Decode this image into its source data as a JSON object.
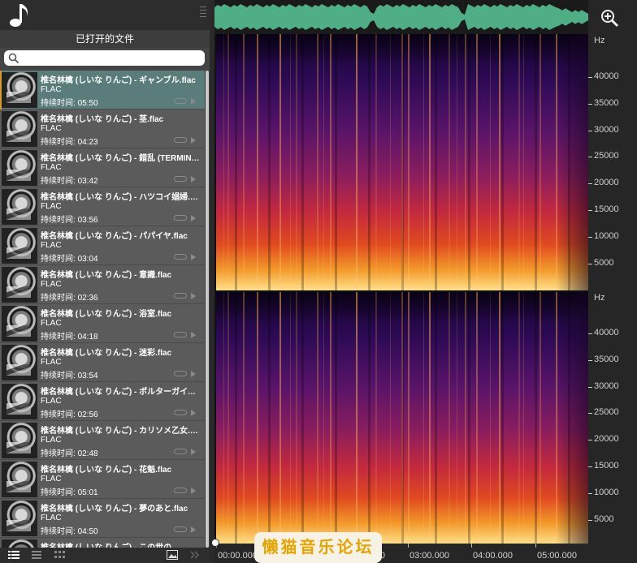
{
  "sidebar": {
    "title": "已打开的文件",
    "search": {
      "value": "",
      "placeholder": ""
    },
    "files": [
      {
        "name": "椎名林檎 (しいな りんご) - ギャンブル.flac",
        "format": "FLAC",
        "duration_label": "持续时间: ",
        "duration": "05:50",
        "active": true
      },
      {
        "name": "椎名林檎 (しいな りんご) - 茎.flac",
        "format": "FLAC",
        "duration_label": "持续时间: ",
        "duration": "04:23"
      },
      {
        "name": "椎名林檎 (しいな りんご) - 錯乱 (TERMINAL).flac",
        "format": "FLAC",
        "duration_label": "持续时间: ",
        "duration": "03:42"
      },
      {
        "name": "椎名林檎 (しいな りんご) - ハツコイ娼婦.flac",
        "format": "FLAC",
        "duration_label": "持续时间: ",
        "duration": "03:56"
      },
      {
        "name": "椎名林檎 (しいな りんご) - パパイヤ.flac",
        "format": "FLAC",
        "duration_label": "持续时间: ",
        "duration": "03:04"
      },
      {
        "name": "椎名林檎 (しいな りんご) - 意識.flac",
        "format": "FLAC",
        "duration_label": "持续时间: ",
        "duration": "02:36"
      },
      {
        "name": "椎名林檎 (しいな りんご) - 浴室.flac",
        "format": "FLAC",
        "duration_label": "持续时间: ",
        "duration": "04:18"
      },
      {
        "name": "椎名林檎 (しいな りんご) - 迷彩.flac",
        "format": "FLAC",
        "duration_label": "持续时间: ",
        "duration": "03:54"
      },
      {
        "name": "椎名林檎 (しいな りんご) - ポルターガイスト.flac",
        "format": "FLAC",
        "duration_label": "持续时间: ",
        "duration": "02:56"
      },
      {
        "name": "椎名林檎 (しいな りんご) - カリソメ乙女.flac",
        "format": "FLAC",
        "duration_label": "持续时间: ",
        "duration": "02:48"
      },
      {
        "name": "椎名林檎 (しいな りんご) - 花魁.flac",
        "format": "FLAC",
        "duration_label": "持续时间: ",
        "duration": "05:01"
      },
      {
        "name": "椎名林檎 (しいな りんご) - 夢のあと.flac",
        "format": "FLAC",
        "duration_label": "持续时间: ",
        "duration": "04:50"
      },
      {
        "name": "椎名林檎 (しいな りんご) - この世の",
        "format": "FLAC",
        "duration_label": "持续时间: ",
        "duration": ""
      }
    ]
  },
  "spectrogram": {
    "frequency_axis_unit": "Hz",
    "frequency_ticks": [
      "40000",
      "35000",
      "30000",
      "25000",
      "20000",
      "15000",
      "10000",
      "5000"
    ],
    "time_ticks": [
      "00:00.000",
      "01:00.000",
      "02:00.000",
      "03:00.000",
      "04:00.000",
      "05:00.000"
    ]
  },
  "icons": {
    "app": "music-note-icon",
    "search": "search-icon",
    "zoom": "zoom-in-icon",
    "view_list": "list-view-icon",
    "view_detail": "detail-view-icon",
    "view_grid": "grid-view-icon",
    "image": "image-icon",
    "collapse": "collapse-icon"
  },
  "colors": {
    "active_row": "#5a7d7b",
    "active_marker": "#d89a2c",
    "waveform": "#4fae86"
  },
  "watermark": "懒猫音乐论坛"
}
